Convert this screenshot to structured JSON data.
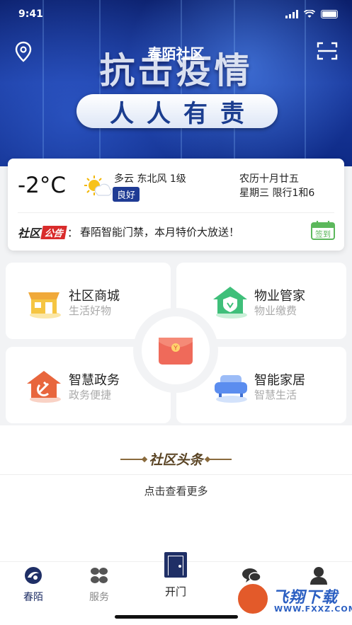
{
  "app": {
    "title": "春陌社区"
  },
  "status_bar": {
    "time": "9:41"
  },
  "banner": {
    "headline": "抗击疫情",
    "slogan": "人人有责"
  },
  "weather": {
    "temperature": "-2°C",
    "icon": "partly-cloudy-icon",
    "description": "多云 东北风 1级",
    "air_quality": "良好",
    "lunar_date": "农历十月廿五",
    "weekday_restriction": "星期三 限行1和6"
  },
  "notice": {
    "logo_part1": "社区",
    "logo_part2": "公告",
    "separator": "：",
    "text": "春陌智能门禁，本月特价大放送！",
    "checkin_label": "签到"
  },
  "services": [
    {
      "title": "社区商城",
      "subtitle": "生活好物",
      "icon": "shop-icon",
      "color": "#f5c542"
    },
    {
      "title": "物业管家",
      "subtitle": "物业缴费",
      "icon": "house-shield-icon",
      "color": "#3fbf7a"
    },
    {
      "title": "智慧政务",
      "subtitle": "政务便捷",
      "icon": "party-house-icon",
      "color": "#e8663d"
    },
    {
      "title": "智能家居",
      "subtitle": "智慧生活",
      "icon": "sofa-icon",
      "color": "#5b8def"
    }
  ],
  "center_button": {
    "icon": "red-envelope-icon"
  },
  "headlines": {
    "title": "社区头条",
    "more": "点击查看更多"
  },
  "tabbar": [
    {
      "label": "春陌",
      "icon": "home-logo-icon",
      "active": true
    },
    {
      "label": "服务",
      "icon": "grid-icon",
      "active": false
    },
    {
      "label": "开门",
      "icon": "door-icon",
      "active": false
    },
    {
      "label": "",
      "icon": "chat-icon",
      "active": false
    },
    {
      "label": "",
      "icon": "user-icon",
      "active": false
    }
  ],
  "watermark": {
    "text": "飞翔下载",
    "url": "WWW.FXXZ.COM"
  },
  "colors": {
    "primary": "#1f2f66",
    "accent_red": "#d92b2b",
    "headline_gold": "#5a4424"
  }
}
